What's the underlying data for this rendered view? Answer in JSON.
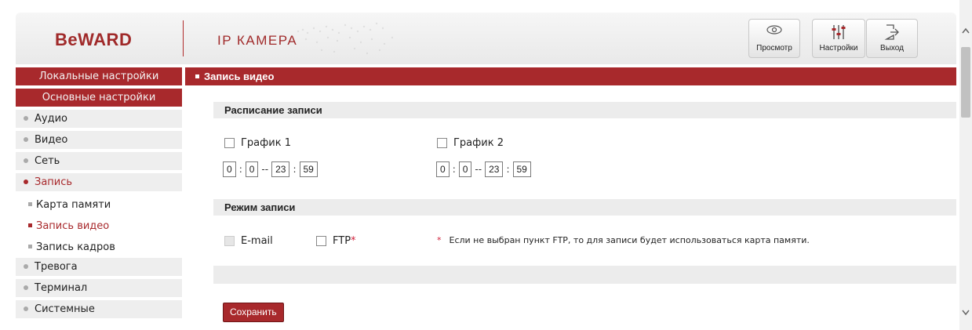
{
  "header": {
    "logo": "BeWARD",
    "subtitle": "IP КАМЕРА",
    "buttons": {
      "view": "Просмотр",
      "settings": "Настройки",
      "exit": "Выход"
    },
    "icons": {
      "view": "eye-icon",
      "settings": "sliders-icon",
      "exit": "exit-icon"
    }
  },
  "sidebar": {
    "local_settings": "Локальные настройки",
    "main_settings": "Основные настройки",
    "items": [
      {
        "label": "Аудио"
      },
      {
        "label": "Видео"
      },
      {
        "label": "Сеть"
      },
      {
        "label": "Запись"
      }
    ],
    "sub_items": [
      {
        "label": "Карта памяти"
      },
      {
        "label": "Запись видео"
      },
      {
        "label": "Запись кадров"
      }
    ],
    "items2": [
      {
        "label": "Тревога"
      },
      {
        "label": "Терминал"
      },
      {
        "label": "Системные"
      }
    ]
  },
  "main": {
    "title": "Запись видео",
    "schedule": {
      "heading": "Расписание записи",
      "s1": {
        "label": "График 1",
        "h1": "0",
        "m1": "0",
        "h2": "23",
        "m2": "59"
      },
      "s2": {
        "label": "График 2",
        "h1": "0",
        "m1": "0",
        "h2": "23",
        "m2": "59"
      },
      "colon": ":",
      "dash": "--"
    },
    "mode": {
      "heading": "Режим записи",
      "email": "E-mail",
      "ftp": "FTP",
      "ftp_star": "*",
      "note_star": "*",
      "note": "Если не выбран пункт FTP, то для записи будет использоваться карта памяти."
    },
    "save": "Сохранить"
  },
  "colors": {
    "accent": "#a8292c",
    "section_bg": "#ececec"
  }
}
